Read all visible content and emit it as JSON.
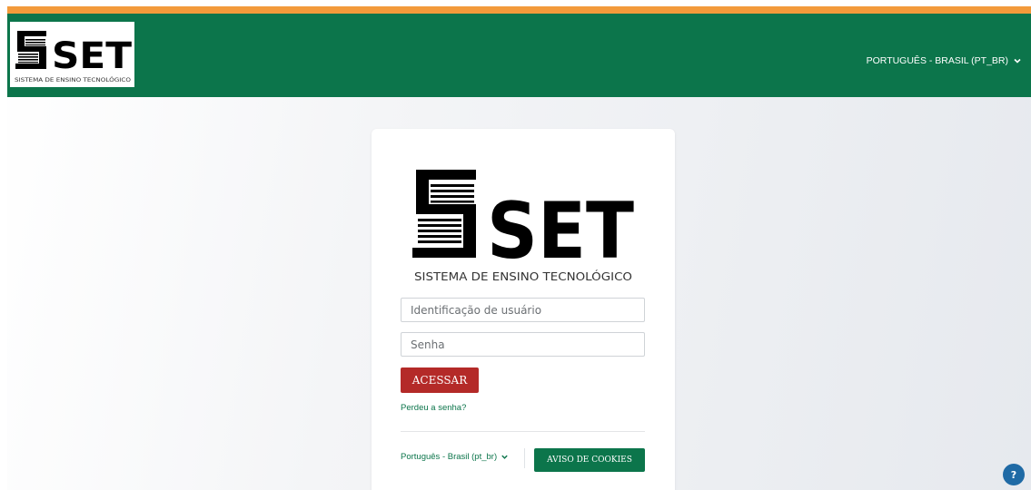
{
  "colors": {
    "top_stripe": "#f39a3b",
    "navbar": "#0c754b",
    "login_button": "#b42a28",
    "cookies_button": "#0c754b",
    "help_button": "#1f6aa5"
  },
  "header": {
    "logo": {
      "icon": "set-logo",
      "wordmark": "SET",
      "subtitle": "SISTEMA DE ENSINO TECNOLÓGICO"
    },
    "language_menu": {
      "label": "PORTUGUÊS - BRASIL (PT_BR)",
      "icon": "chevron-down-icon"
    }
  },
  "login": {
    "logo": {
      "icon": "set-logo",
      "wordmark": "SET",
      "subtitle": "SISTEMA DE ENSINO TECNOLÓGICO"
    },
    "username_placeholder": "Identificação de usuário",
    "password_placeholder": "Senha",
    "submit_label": "ACESSAR",
    "forgot_password_label": "Perdeu a senha?",
    "language_select": {
      "selected": "Português - Brasil (pt_br)",
      "icon": "chevron-down-icon"
    },
    "cookies_label": "AVISO DE COOKIES"
  },
  "help": {
    "icon": "question-icon",
    "label": "?"
  }
}
